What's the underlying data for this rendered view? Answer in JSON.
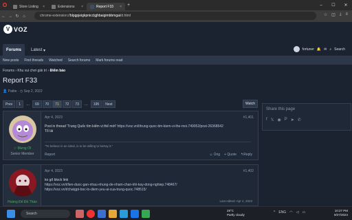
{
  "browser": {
    "tabs": [
      {
        "title": "Store Listing"
      },
      {
        "title": "Extensions"
      },
      {
        "title": "Report F33",
        "active": true
      }
    ],
    "url_prefix": "chrome-extension://",
    "url_host": "blpgpjeigkpnicclgjhbaigimbbmgai",
    "url_path": "/d.html"
  },
  "site": {
    "logo": "VOZ",
    "nav": [
      "Forums",
      "Latest"
    ],
    "nav_latest_caret": "▾",
    "user": "fortuner",
    "search": "Search",
    "subnav": [
      "New posts",
      "Find threads",
      "Watched",
      "Search forums",
      "Mark forums read"
    ]
  },
  "breadcrumb": {
    "a": "Forums",
    "b": "Khu vui chơi giải trí",
    "c": "Điểm báo"
  },
  "page": {
    "title": "Report F33",
    "author": "Pattie",
    "date": "Sep 2, 2022"
  },
  "pager": [
    "Prev",
    "1",
    "…",
    "69",
    "70",
    "71",
    "72",
    "73",
    "…",
    "195",
    "Next"
  ],
  "watch": "Watch",
  "share": {
    "title": "Share this page",
    "icons": [
      "f",
      "𝕏",
      "reddit",
      "P",
      "T",
      "wa"
    ]
  },
  "posts": [
    {
      "date": "Apr 4, 2023",
      "num": "#1,401",
      "user": "☆ Mưng Ơi",
      "role": "Senior Member",
      "line1": "Post in thread 'Trung Quốc tìm kiếm vị thế mới'",
      "link1": "https://voz.vn/t/trung-quoc-tim-kiem-vi-the-moi.749052/post-26368542",
      "line2": "Tổ lái",
      "sig": "\"To believe in an ideal, is to be willing to betray it.\"",
      "report": "Report",
      "actions": [
        "Ủng",
        "+ Quote",
        "Reply"
      ]
    },
    {
      "date": "Apr 4, 2023",
      "num": "#1,402",
      "user": "Hoàng Đế Đồ Thần",
      "role": "",
      "line1": "ko gõ block link",
      "link1": "https://voz.vn/t/lien-duoc-gan-nhau-nhung-de-nham-chan-khi-kay-dong-nghiep.748467/",
      "link2": "https://voz.vn/t/chatgpt-boc-lo-diem-yeu-ai-cua-trung-quoc.748515/",
      "edited": "Last edited: Apr 4, 2023"
    }
  ],
  "taskbar": {
    "search": "Search",
    "weather_temp": "29°C",
    "weather_desc": "Partly cloudy",
    "lang": "ENG",
    "time": "10:27 PM",
    "date": "9/27/2024"
  },
  "colors": {
    "bg": "#1b2330",
    "accent": "#2c3849",
    "link": "#8aa7c7",
    "username": "#47b35c"
  }
}
